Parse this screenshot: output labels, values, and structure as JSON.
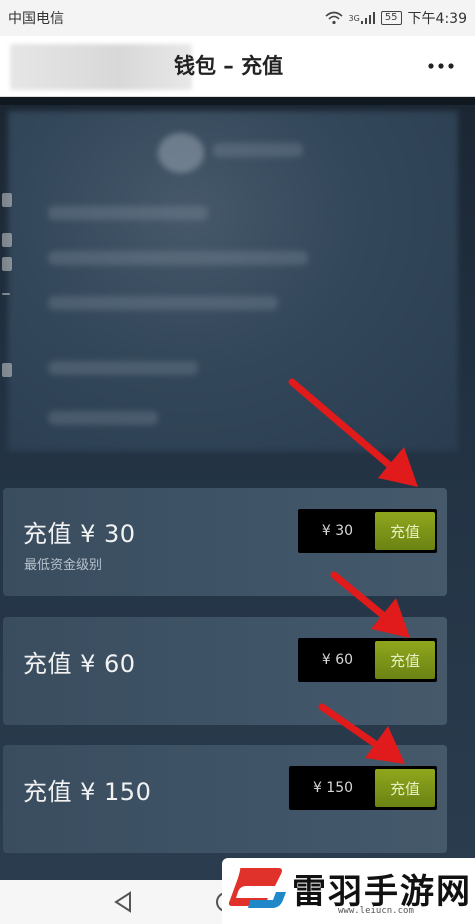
{
  "status_bar": {
    "carrier": "中国电信",
    "signal_label": "3G",
    "battery": "55",
    "time": "下午4:39"
  },
  "title_bar": {
    "title": "钱包 – 充值",
    "menu_icon": "more-dots-icon"
  },
  "wallet_options": [
    {
      "title": "充值 ¥ 30",
      "subtitle": "最低资金级别",
      "price": "¥ 30",
      "button": "充值"
    },
    {
      "title": "充值 ¥ 60",
      "subtitle": "",
      "price": "¥ 60",
      "button": "充值"
    },
    {
      "title": "充值 ¥ 150",
      "subtitle": "",
      "price": "¥ 150",
      "button": "充值"
    }
  ],
  "colors": {
    "accent_button": "#7a9418",
    "arrow": "#e11b1b",
    "page_bg": "#223243"
  },
  "watermark": {
    "text": "雷羽手游网",
    "url": "www.leiucn.com"
  }
}
